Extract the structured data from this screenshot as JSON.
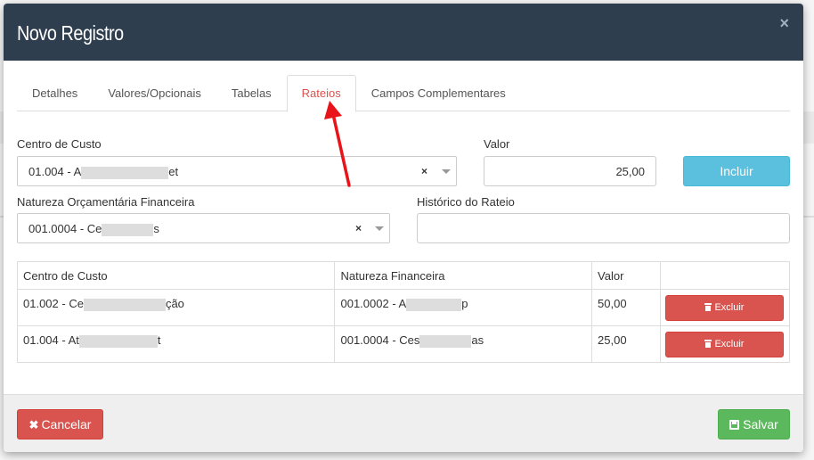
{
  "modal": {
    "title": "Novo Registro",
    "close_glyph": "×"
  },
  "tabs": [
    {
      "label": "Detalhes"
    },
    {
      "label": "Valores/Opcionais"
    },
    {
      "label": "Tabelas"
    },
    {
      "label": "Rateios",
      "active": true
    },
    {
      "label": "Campos Complementares"
    }
  ],
  "form": {
    "centro_custo": {
      "label": "Centro de Custo",
      "value_prefix": "01.004 - A",
      "value_suffix": "et",
      "clear_glyph": "×"
    },
    "valor": {
      "label": "Valor",
      "value": "25,00"
    },
    "incluir_label": "Incluir",
    "natureza": {
      "label": "Natureza Orçamentária Financeira",
      "value_prefix": "001.0004 - Ce",
      "value_suffix": "s",
      "clear_glyph": "×"
    },
    "historico": {
      "label": "Histórico do Rateio",
      "value": ""
    }
  },
  "table": {
    "headers": {
      "centro": "Centro de Custo",
      "natureza": "Natureza Financeira",
      "valor": "Valor"
    },
    "rows": [
      {
        "centro_prefix": "01.002 - Ce",
        "centro_suffix": "ção",
        "natureza_prefix": "001.0002 - A",
        "natureza_suffix": "p",
        "valor": "50,00",
        "excluir_label": "Excluir"
      },
      {
        "centro_prefix": "01.004 - At",
        "centro_suffix": "t",
        "natureza_prefix": "001.0004 - Ces",
        "natureza_suffix": "as",
        "valor": "25,00",
        "excluir_label": "Excluir"
      }
    ]
  },
  "footer": {
    "cancelar_label": "Cancelar",
    "cancelar_glyph": "✖",
    "salvar_label": "Salvar"
  },
  "colors": {
    "header_bg": "#2f3e4e",
    "active_tab": "#d9534f",
    "incluir": "#5bc0de",
    "danger": "#d9534f",
    "success": "#5cb85c",
    "annotation_arrow": "#e8141a"
  },
  "icons": [
    "close-icon",
    "trash-icon",
    "cancel-x-icon",
    "save-icon",
    "chevron-down-icon"
  ]
}
